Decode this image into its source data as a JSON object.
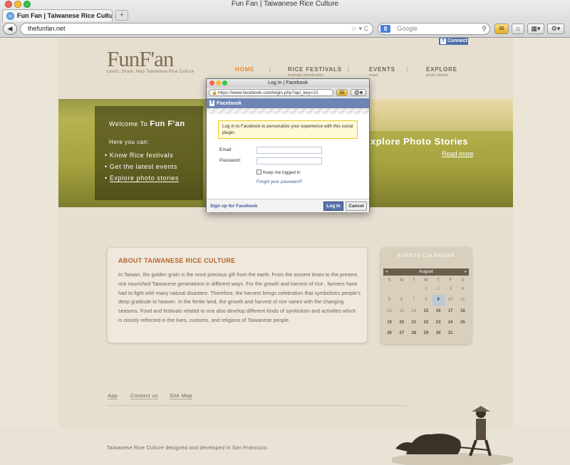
{
  "window": {
    "title": "Fun Fan | Taiwanese Rice Culture",
    "traffic_colors": [
      "#fc5f57",
      "#fdbc2e",
      "#33c748"
    ]
  },
  "tab": {
    "label": "Fun Fan | Taiwanese Rice Culture",
    "close": "x",
    "new_tab": "+"
  },
  "toolbar": {
    "back": "◀",
    "url": "thefunfan.net",
    "url_icons": "☆ ▾ C",
    "search_placeholder": "Google",
    "search_engine": "8",
    "search_icon": "🔍"
  },
  "site": {
    "fb_connect": "Connect",
    "logo": {
      "word": "FunF'an",
      "tagline": "Learn, Share, Map Taiwanese Rice Culture"
    },
    "nav": [
      {
        "label": "HOME",
        "sub": "",
        "color": "#e38a2a"
      },
      {
        "label": "RICE FESTIVALS",
        "sub": "festivals introduction",
        "color": "#6d6454"
      },
      {
        "label": "EVENTS",
        "sub": "news",
        "color": "#6d6454"
      },
      {
        "label": "EXPLORE",
        "sub": "photo stories",
        "color": "#6d6454"
      }
    ],
    "nav_sep": "|",
    "hero": {
      "welcome": "Welcome To",
      "brand": "Fun F'an",
      "here_you_can": "Here you can:",
      "items": [
        "Know Rice festivals",
        "Get the latest events",
        "Explore photo stories"
      ],
      "explore_title": "xplore Photo Stories",
      "read_more": "Read more"
    },
    "about": {
      "title": "ABOUT TAIWANESE RICE CULTURE",
      "body": "In Taiwan, the golden grain is the most precious gift from the earth. From the ancient times to the present, rice nourished Taiwanese generations in different ways. For the growth and harvest of rice , farmers have had to fight with many natural disasters. Therefore, the harvest brings celebration that symbolizes people's deep gratitude to heaven. In the fertile land, the growth and harvest of rice varies with the changing seasons. Food and festivals related to rice also develop different kinds of symbolism and activities which is closely reflected in the lives, customs, and religions of Taiwanese people."
    },
    "calendar": {
      "title": "EVENTS CALENDAR",
      "month": "August",
      "prev": "«",
      "next": "»",
      "days_of_week": [
        "S",
        "M",
        "T",
        "W",
        "T",
        "F",
        "S"
      ],
      "weeks": [
        [
          "",
          "",
          "",
          "1",
          "2",
          "3",
          "4"
        ],
        [
          "5",
          "6",
          "7",
          "8",
          "9",
          "10",
          "11"
        ],
        [
          "12",
          "13",
          "14",
          "15",
          "16",
          "17",
          "18"
        ],
        [
          "19",
          "20",
          "21",
          "22",
          "23",
          "24",
          "25"
        ],
        [
          "26",
          "27",
          "28",
          "29",
          "30",
          "31",
          ""
        ]
      ],
      "today": "9"
    },
    "footer": {
      "links": [
        "App",
        "Contact us",
        "Site Map"
      ],
      "copyright": "Taiwanese Rice Culture designed and developed in San Francisco."
    }
  },
  "facebook_popup": {
    "window_title": "Log In | Facebook",
    "url": "https://www.facebook.com/login.php?api_key=22",
    "brand": "Facebook",
    "message": "Log in to Facebook to personalize your experience with this social plugin.",
    "email_label": "Email:",
    "password_label": "Password:",
    "keep_logged_in": "Keep me logged in",
    "forgot": "Forgot your password?",
    "signup": "Sign up for Facebook",
    "login": "Log In",
    "cancel": "Cancel"
  }
}
